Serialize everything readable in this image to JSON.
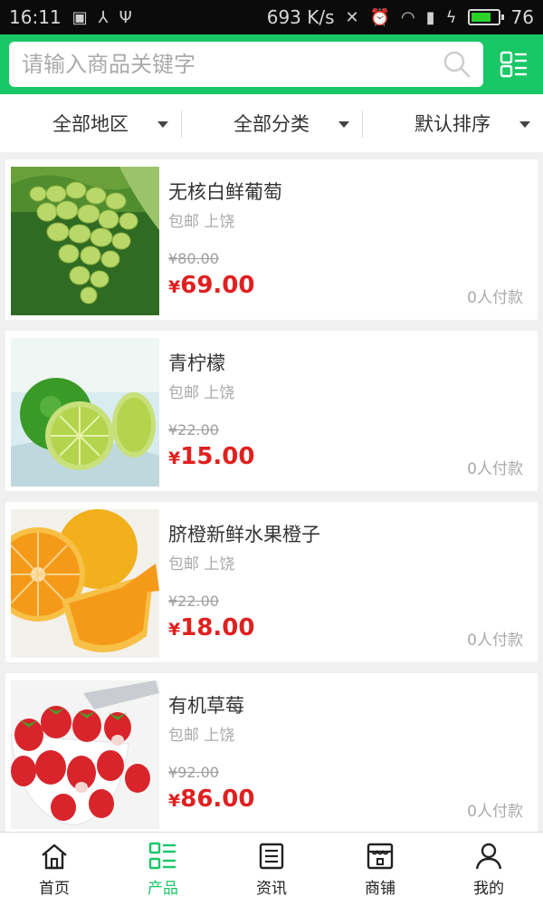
{
  "status_bar": {
    "time": "16:11",
    "speed": "693 K/s",
    "battery_level": "76",
    "battery_fraction": 0.76
  },
  "search": {
    "placeholder": "请输入商品关键字"
  },
  "filters": [
    {
      "label": "全部地区"
    },
    {
      "label": "全部分类"
    },
    {
      "label": "默认排序"
    }
  ],
  "products": [
    {
      "name": "无核白鲜葡萄",
      "tags": "包邮 上饶",
      "old_price": "¥80.00",
      "currency": "¥",
      "price": "69.00",
      "sold": "0人付款",
      "image": "green-grapes"
    },
    {
      "name": "青柠檬",
      "tags": "包邮 上饶",
      "old_price": "¥22.00",
      "currency": "¥",
      "price": "15.00",
      "sold": "0人付款",
      "image": "green-limes"
    },
    {
      "name": "脐橙新鲜水果橙子",
      "tags": "包邮 上饶",
      "old_price": "¥22.00",
      "currency": "¥",
      "price": "18.00",
      "sold": "0人付款",
      "image": "navel-oranges"
    },
    {
      "name": "有机草莓",
      "tags": "包邮 上饶",
      "old_price": "¥92.00",
      "currency": "¥",
      "price": "86.00",
      "sold": "0人付款",
      "image": "strawberries"
    }
  ],
  "bottom_nav": [
    {
      "label": "首页",
      "icon": "home-icon",
      "active": false
    },
    {
      "label": "产品",
      "icon": "product-list-icon",
      "active": true
    },
    {
      "label": "资讯",
      "icon": "news-icon",
      "active": false
    },
    {
      "label": "商铺",
      "icon": "store-icon",
      "active": false
    },
    {
      "label": "我的",
      "icon": "user-icon",
      "active": false
    }
  ],
  "colors": {
    "brand_green": "#19c766",
    "price_red": "#e02020",
    "muted_text": "#aaaaaa"
  }
}
